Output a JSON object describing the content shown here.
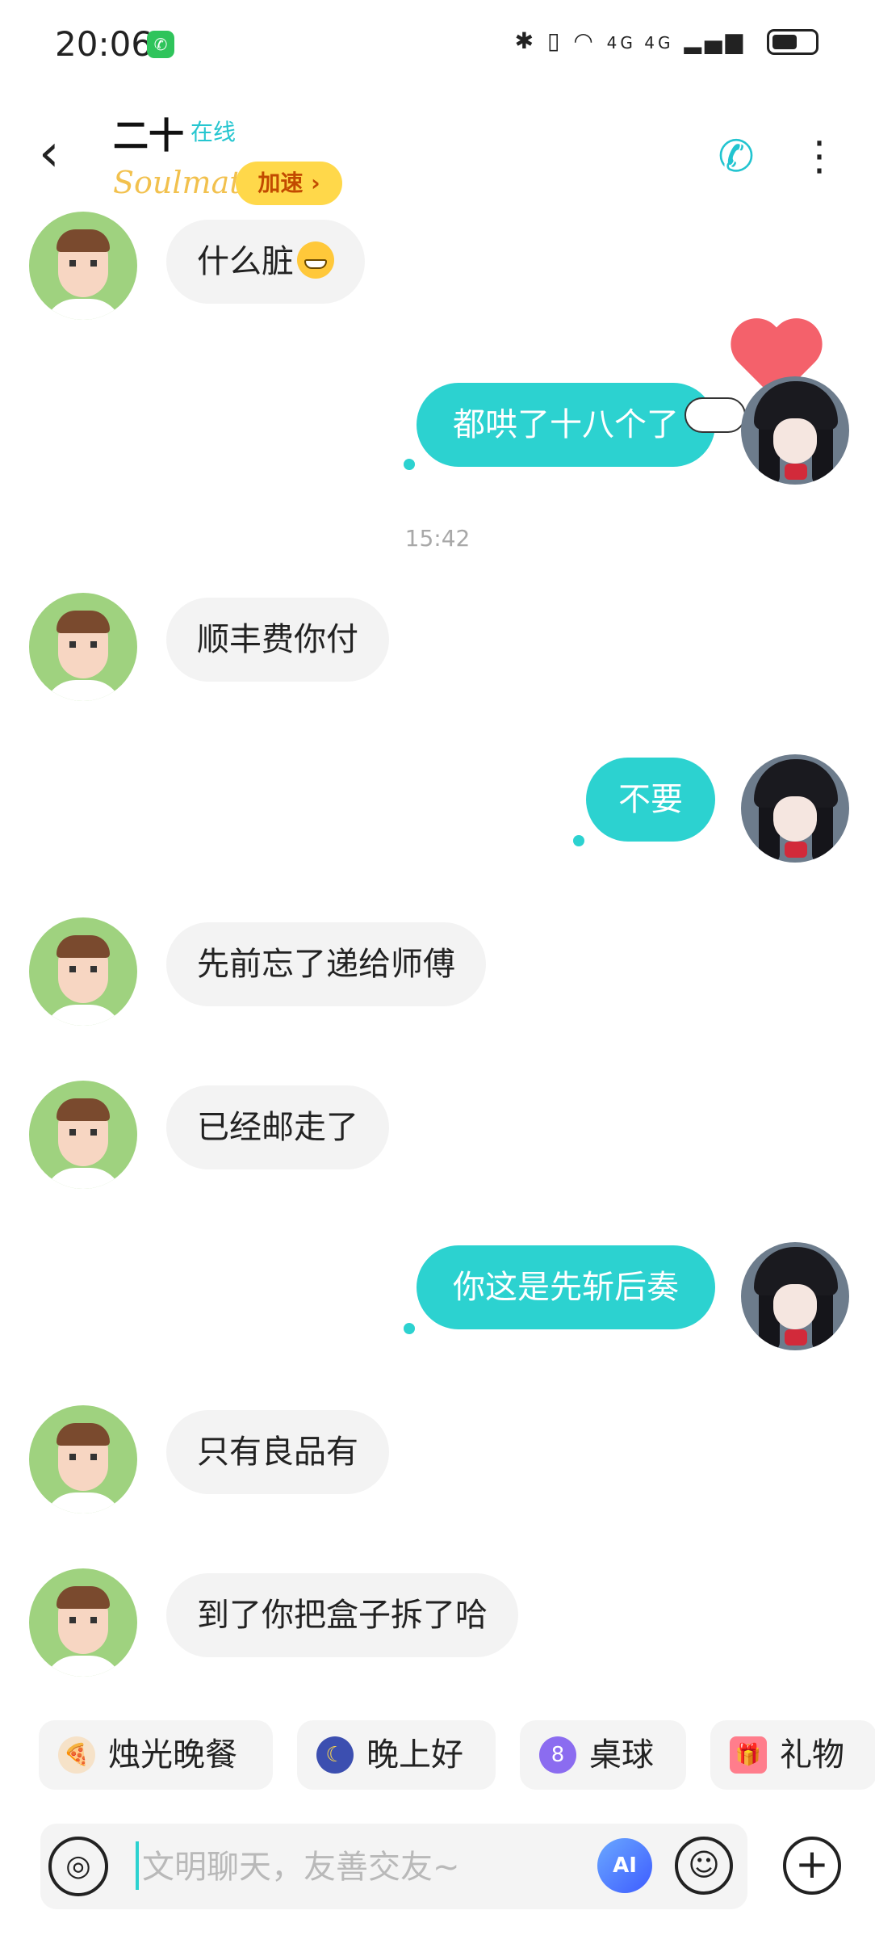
{
  "status_bar": {
    "time": "20:06",
    "network_labels": "4G 4G",
    "app_notification_icon": "wechat-icon"
  },
  "header": {
    "contact_name": "二十",
    "status": "在线",
    "badge": "Soulmate",
    "speed_button": "加速 ›",
    "call_icon": "video-call-icon",
    "more_icon": "more-vertical-icon"
  },
  "messages": [
    {
      "side": "left",
      "text": "什么脏",
      "emoji": "grinning-face"
    },
    {
      "side": "right",
      "text": "都哄了十八个了"
    },
    {
      "type": "timestamp",
      "text": "15:42"
    },
    {
      "side": "left",
      "text": "顺丰费你付"
    },
    {
      "side": "right",
      "text": "不要"
    },
    {
      "side": "left",
      "text": "先前忘了递给师傅"
    },
    {
      "side": "left",
      "text": "已经邮走了"
    },
    {
      "side": "right",
      "text": "你这是先斩后奏"
    },
    {
      "side": "left",
      "text": "只有良品有"
    },
    {
      "side": "left",
      "text": "到了你把盒子拆了哈"
    }
  ],
  "quick_actions": [
    {
      "label": "烛光晚餐",
      "icon": "dinner-icon"
    },
    {
      "label": "晚上好",
      "icon": "moon-icon"
    },
    {
      "label": "桌球",
      "icon": "billiard-ball-icon"
    },
    {
      "label": "礼物",
      "icon": "gift-icon"
    }
  ],
  "composer": {
    "placeholder": "文明聊天，友善交友~",
    "value": "",
    "ai_label": "AI"
  },
  "colors": {
    "accent": "#2cd2d0",
    "bubble_left": "#f3f3f3",
    "speed_badge": "#ffd84a"
  }
}
